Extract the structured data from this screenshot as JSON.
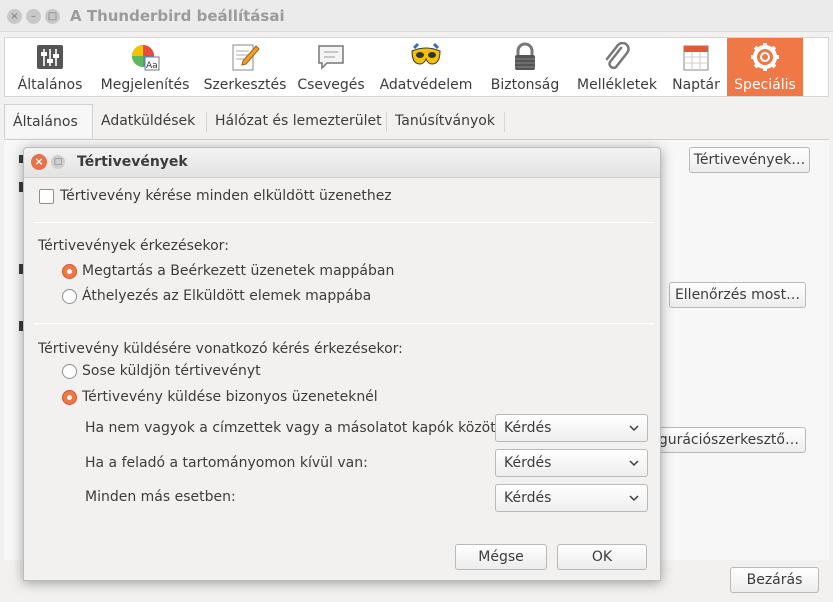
{
  "window": {
    "title": "A Thunderbird beállításai",
    "controls": {
      "close": "×",
      "minimize": "–",
      "maximize": "□"
    }
  },
  "toolbar": {
    "items": [
      {
        "label": "Általános",
        "icon": "sliders-icon"
      },
      {
        "label": "Megjelenítés",
        "icon": "palette-icon"
      },
      {
        "label": "Szerkesztés",
        "icon": "pencil-icon"
      },
      {
        "label": "Csevegés",
        "icon": "chat-icon"
      },
      {
        "label": "Adatvédelem",
        "icon": "mask-icon"
      },
      {
        "label": "Biztonság",
        "icon": "lock-icon"
      },
      {
        "label": "Mellékletek",
        "icon": "paperclip-icon"
      },
      {
        "label": "Naptár",
        "icon": "calendar-icon"
      },
      {
        "label": "Speciális",
        "icon": "gear-icon",
        "active": true
      }
    ],
    "accent": "#f07746"
  },
  "tabs": [
    {
      "label": "Általános",
      "active": true
    },
    {
      "label": "Adatküldések"
    },
    {
      "label": "Hálózat és lemezterület"
    },
    {
      "label": "Tanúsítványok"
    }
  ],
  "background_buttons": {
    "receipts": "Tértivevények…",
    "check_now": "Ellenőrzés most…",
    "config_editor": "gurációszerkesztő…",
    "close": "Bezárás"
  },
  "dialog": {
    "title": "Tértivevények",
    "controls": {
      "close": "×",
      "maximize": "□"
    },
    "request_all": {
      "label": "Tértivevény kérése minden elküldött üzenethez",
      "checked": false
    },
    "arrival_heading": "Tértivevények érkezésekor:",
    "arrival_options": [
      {
        "label": "Megtartás a Beérkezett üzenetek mappában",
        "selected": true
      },
      {
        "label": "Áthelyezés az Elküldött elemek mappába",
        "selected": false
      }
    ],
    "request_heading": "Tértivevény küldésére vonatkozó kérés érkezésekor:",
    "request_options": [
      {
        "label": "Sose küldjön tértivevényt",
        "selected": false
      },
      {
        "label": "Tértivevény küldése bizonyos üzeneteknél",
        "selected": true
      }
    ],
    "rules": [
      {
        "label": "Ha nem vagyok a címzettek vagy a másolatot kapók között:",
        "value": "Kérdés"
      },
      {
        "label": "Ha a feladó a tartományomon kívül van:",
        "value": "Kérdés"
      },
      {
        "label": "Minden más esetben:",
        "value": "Kérdés"
      }
    ],
    "cancel": "Mégse",
    "ok": "OK"
  }
}
